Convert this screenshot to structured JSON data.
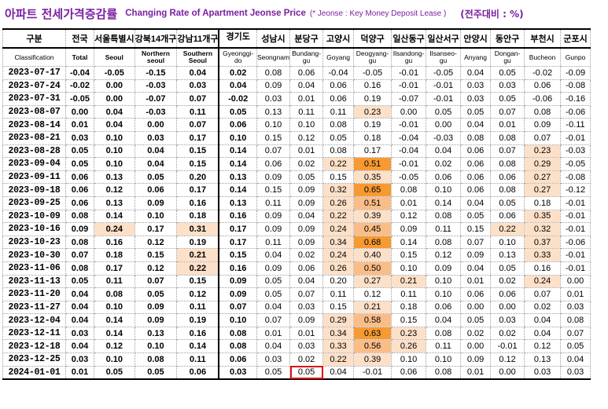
{
  "title": {
    "korean": "아파트 전세가격증감률",
    "english": "Changing Rate of Apartment Jeonse Price",
    "note": "(* Jeonse : Key Money Deposit Lease )",
    "unit": "(전주대비 : %)"
  },
  "columns": [
    {
      "ko": "구분",
      "en": "Classification"
    },
    {
      "ko": "전국",
      "en": "Total"
    },
    {
      "ko": "서울특별시",
      "en": "Seoul"
    },
    {
      "ko": "강북14개구",
      "en": "Northern seoul"
    },
    {
      "ko": "강남11개구",
      "en": "Southern Seoul"
    },
    {
      "ko": "경기도",
      "en": "Gyeonggi-do"
    },
    {
      "ko": "성남시",
      "en": "Seongnam"
    },
    {
      "ko": "분당구",
      "en": "Bundang-gu"
    },
    {
      "ko": "고양시",
      "en": "Goyang"
    },
    {
      "ko": "덕양구",
      "en": "Deogyang-gu"
    },
    {
      "ko": "일산동구",
      "en": "Ilsandong-gu"
    },
    {
      "ko": "일산서구",
      "en": "Ilsanseo-gu"
    },
    {
      "ko": "안양시",
      "en": "Anyang"
    },
    {
      "ko": "동안구",
      "en": "Dongan-gu"
    },
    {
      "ko": "부천시",
      "en": "Bucheon"
    },
    {
      "ko": "군포시",
      "en": "Gunpo"
    }
  ],
  "rows": [
    {
      "date": "2023-07-17",
      "values": [
        "-0.04",
        "-0.05",
        "-0.15",
        "0.04",
        "0.02",
        "0.08",
        "0.06",
        "-0.04",
        "-0.05",
        "-0.01",
        "-0.05",
        "0.04",
        "0.05",
        "-0.02",
        "-0.09"
      ],
      "highlight": [
        0,
        0,
        0,
        0,
        0,
        0,
        0,
        0,
        0,
        0,
        0,
        0,
        0,
        0,
        0
      ]
    },
    {
      "date": "2023-07-24",
      "values": [
        "-0.02",
        "0.00",
        "-0.03",
        "0.03",
        "0.04",
        "0.09",
        "0.04",
        "0.06",
        "0.16",
        "-0.01",
        "-0.01",
        "0.03",
        "0.03",
        "0.06",
        "-0.08"
      ],
      "highlight": [
        0,
        0,
        0,
        0,
        0,
        0,
        0,
        0,
        0,
        0,
        0,
        0,
        0,
        0,
        0
      ]
    },
    {
      "date": "2023-07-31",
      "values": [
        "-0.05",
        "0.00",
        "-0.07",
        "0.07",
        "-0.02",
        "0.03",
        "0.01",
        "0.06",
        "0.19",
        "-0.07",
        "-0.01",
        "0.03",
        "0.05",
        "-0.06",
        "-0.16"
      ],
      "highlight": [
        0,
        0,
        0,
        0,
        0,
        0,
        0,
        0,
        0,
        0,
        0,
        0,
        0,
        0,
        0
      ]
    },
    {
      "date": "2023-08-07",
      "values": [
        "0.00",
        "0.04",
        "-0.03",
        "0.11",
        "0.05",
        "0.13",
        "0.11",
        "0.11",
        "0.23",
        "0.00",
        "0.05",
        "0.05",
        "0.07",
        "0.08",
        "-0.06"
      ],
      "highlight": [
        0,
        0,
        0,
        0,
        0,
        0,
        0,
        0,
        1,
        0,
        0,
        0,
        0,
        0,
        0
      ]
    },
    {
      "date": "2023-08-14",
      "values": [
        "0.01",
        "0.04",
        "0.00",
        "0.07",
        "0.06",
        "0.10",
        "0.10",
        "0.08",
        "0.19",
        "-0.01",
        "0.00",
        "0.04",
        "0.01",
        "0.09",
        "-0.11"
      ],
      "highlight": [
        0,
        0,
        0,
        0,
        0,
        0,
        0,
        0,
        0,
        0,
        0,
        0,
        0,
        0,
        0
      ]
    },
    {
      "date": "2023-08-21",
      "values": [
        "0.03",
        "0.10",
        "0.03",
        "0.17",
        "0.10",
        "0.15",
        "0.12",
        "0.05",
        "0.18",
        "-0.04",
        "-0.03",
        "0.08",
        "0.08",
        "0.07",
        "-0.01"
      ],
      "highlight": [
        0,
        0,
        0,
        0,
        0,
        0,
        0,
        0,
        0,
        0,
        0,
        0,
        0,
        0,
        0
      ]
    },
    {
      "date": "2023-08-28",
      "values": [
        "0.05",
        "0.10",
        "0.04",
        "0.15",
        "0.14",
        "0.07",
        "0.01",
        "0.08",
        "0.17",
        "-0.04",
        "0.04",
        "0.06",
        "0.07",
        "0.23",
        "-0.03"
      ],
      "highlight": [
        0,
        0,
        0,
        0,
        0,
        0,
        0,
        0,
        0,
        0,
        0,
        0,
        0,
        1,
        0
      ]
    },
    {
      "date": "2023-09-04",
      "values": [
        "0.05",
        "0.10",
        "0.04",
        "0.15",
        "0.14",
        "0.06",
        "0.02",
        "0.22",
        "0.51",
        "-0.01",
        "0.02",
        "0.06",
        "0.08",
        "0.29",
        "-0.05"
      ],
      "highlight": [
        0,
        0,
        0,
        0,
        0,
        0,
        0,
        1,
        3,
        0,
        0,
        0,
        0,
        1,
        0
      ]
    },
    {
      "date": "2023-09-11",
      "values": [
        "0.06",
        "0.13",
        "0.05",
        "0.20",
        "0.13",
        "0.09",
        "0.05",
        "0.15",
        "0.35",
        "-0.05",
        "0.06",
        "0.06",
        "0.06",
        "0.27",
        "-0.08"
      ],
      "highlight": [
        0,
        0,
        0,
        0,
        0,
        0,
        0,
        0,
        1,
        0,
        0,
        0,
        0,
        1,
        0
      ]
    },
    {
      "date": "2023-09-18",
      "values": [
        "0.06",
        "0.12",
        "0.06",
        "0.17",
        "0.14",
        "0.15",
        "0.09",
        "0.32",
        "0.65",
        "0.08",
        "0.10",
        "0.06",
        "0.08",
        "0.27",
        "-0.12"
      ],
      "highlight": [
        0,
        0,
        0,
        0,
        0,
        0,
        0,
        1,
        3,
        0,
        0,
        0,
        0,
        1,
        0
      ]
    },
    {
      "date": "2023-09-25",
      "values": [
        "0.06",
        "0.13",
        "0.09",
        "0.16",
        "0.13",
        "0.11",
        "0.09",
        "0.26",
        "0.51",
        "0.01",
        "0.14",
        "0.04",
        "0.05",
        "0.18",
        "-0.01"
      ],
      "highlight": [
        0,
        0,
        0,
        0,
        0,
        0,
        0,
        1,
        2,
        0,
        0,
        0,
        0,
        0,
        0
      ]
    },
    {
      "date": "2023-10-09",
      "values": [
        "0.08",
        "0.14",
        "0.10",
        "0.18",
        "0.16",
        "0.09",
        "0.04",
        "0.22",
        "0.39",
        "0.12",
        "0.08",
        "0.05",
        "0.06",
        "0.35",
        "-0.01"
      ],
      "highlight": [
        0,
        0,
        0,
        0,
        0,
        0,
        0,
        1,
        1,
        0,
        0,
        0,
        0,
        1,
        0
      ]
    },
    {
      "date": "2023-10-16",
      "values": [
        "0.09",
        "0.24",
        "0.17",
        "0.31",
        "0.17",
        "0.09",
        "0.09",
        "0.24",
        "0.45",
        "0.09",
        "0.11",
        "0.15",
        "0.22",
        "0.32",
        "-0.01"
      ],
      "highlight": [
        0,
        1,
        0,
        1,
        0,
        0,
        0,
        1,
        2,
        0,
        0,
        0,
        1,
        1,
        0
      ]
    },
    {
      "date": "2023-10-23",
      "values": [
        "0.08",
        "0.16",
        "0.12",
        "0.19",
        "0.17",
        "0.11",
        "0.09",
        "0.34",
        "0.68",
        "0.14",
        "0.08",
        "0.07",
        "0.10",
        "0.37",
        "-0.06"
      ],
      "highlight": [
        0,
        0,
        0,
        0,
        0,
        0,
        0,
        1,
        3,
        0,
        0,
        0,
        0,
        1,
        0
      ]
    },
    {
      "date": "2023-10-30",
      "values": [
        "0.07",
        "0.18",
        "0.15",
        "0.21",
        "0.15",
        "0.04",
        "0.02",
        "0.24",
        "0.40",
        "0.15",
        "0.12",
        "0.09",
        "0.13",
        "0.33",
        "-0.01"
      ],
      "highlight": [
        0,
        0,
        0,
        1,
        0,
        0,
        0,
        1,
        1,
        0,
        0,
        0,
        0,
        1,
        0
      ]
    },
    {
      "date": "2023-11-06",
      "values": [
        "0.08",
        "0.17",
        "0.12",
        "0.22",
        "0.16",
        "0.09",
        "0.06",
        "0.26",
        "0.50",
        "0.10",
        "0.09",
        "0.04",
        "0.05",
        "0.16",
        "-0.01"
      ],
      "highlight": [
        0,
        0,
        0,
        1,
        0,
        0,
        0,
        1,
        2,
        0,
        0,
        0,
        0,
        0,
        0
      ]
    },
    {
      "date": "2023-11-13",
      "values": [
        "0.05",
        "0.11",
        "0.07",
        "0.15",
        "0.09",
        "0.05",
        "0.04",
        "0.20",
        "0.27",
        "0.21",
        "0.10",
        "0.01",
        "0.02",
        "0.24",
        "0.00"
      ],
      "highlight": [
        0,
        0,
        0,
        0,
        0,
        0,
        0,
        0,
        1,
        1,
        0,
        0,
        0,
        1,
        0
      ]
    },
    {
      "date": "2023-11-20",
      "values": [
        "0.04",
        "0.08",
        "0.05",
        "0.12",
        "0.09",
        "0.05",
        "0.07",
        "0.11",
        "0.12",
        "0.11",
        "0.10",
        "0.06",
        "0.06",
        "0.07",
        "0.01"
      ],
      "highlight": [
        0,
        0,
        0,
        0,
        0,
        0,
        0,
        0,
        0,
        0,
        0,
        0,
        0,
        0,
        0
      ]
    },
    {
      "date": "2023-11-27",
      "values": [
        "0.04",
        "0.10",
        "0.09",
        "0.11",
        "0.07",
        "0.04",
        "0.03",
        "0.15",
        "0.21",
        "0.18",
        "0.06",
        "0.00",
        "0.00",
        "0.02",
        "0.03"
      ],
      "highlight": [
        0,
        0,
        0,
        0,
        0,
        0,
        0,
        0,
        1,
        0,
        0,
        0,
        0,
        0,
        0
      ]
    },
    {
      "date": "2023-12-04",
      "values": [
        "0.04",
        "0.14",
        "0.09",
        "0.19",
        "0.10",
        "0.07",
        "0.09",
        "0.29",
        "0.58",
        "0.15",
        "0.04",
        "0.05",
        "0.03",
        "0.04",
        "0.08"
      ],
      "highlight": [
        0,
        0,
        0,
        0,
        0,
        0,
        0,
        1,
        2,
        0,
        0,
        0,
        0,
        0,
        0
      ]
    },
    {
      "date": "2023-12-11",
      "values": [
        "0.03",
        "0.14",
        "0.13",
        "0.16",
        "0.08",
        "0.01",
        "0.01",
        "0.34",
        "0.63",
        "0.23",
        "0.08",
        "0.02",
        "0.02",
        "0.04",
        "0.07"
      ],
      "highlight": [
        0,
        0,
        0,
        0,
        0,
        0,
        0,
        1,
        3,
        1,
        0,
        0,
        0,
        0,
        0
      ]
    },
    {
      "date": "2023-12-18",
      "values": [
        "0.04",
        "0.12",
        "0.10",
        "0.14",
        "0.08",
        "0.04",
        "0.03",
        "0.33",
        "0.56",
        "0.26",
        "0.11",
        "0.00",
        "-0.01",
        "0.12",
        "0.05"
      ],
      "highlight": [
        0,
        0,
        0,
        0,
        0,
        0,
        0,
        1,
        2,
        1,
        0,
        0,
        0,
        0,
        0
      ]
    },
    {
      "date": "2023-12-25",
      "values": [
        "0.03",
        "0.10",
        "0.08",
        "0.11",
        "0.06",
        "0.03",
        "0.02",
        "0.22",
        "0.39",
        "0.10",
        "0.10",
        "0.09",
        "0.12",
        "0.13",
        "0.04"
      ],
      "highlight": [
        0,
        0,
        0,
        0,
        0,
        0,
        0,
        1,
        1,
        0,
        0,
        0,
        0,
        0,
        0
      ]
    },
    {
      "date": "2024-01-01",
      "values": [
        "0.01",
        "0.05",
        "0.05",
        "0.06",
        "0.03",
        "0.05",
        "0.05",
        "0.04",
        "-0.01",
        "0.06",
        "0.08",
        "0.01",
        "0.00",
        "0.03",
        "0.03"
      ],
      "highlight": [
        0,
        0,
        0,
        0,
        0,
        0,
        0,
        0,
        0,
        0,
        0,
        0,
        0,
        0,
        0
      ]
    }
  ],
  "highlight_colors": {
    "light": "#fde0c8",
    "medium": "#fbbd88",
    "strong": "#f79a32"
  },
  "boxed_cell": {
    "row_date": "2024-01-01",
    "column": "Bundang-gu",
    "color": "#e01010"
  }
}
